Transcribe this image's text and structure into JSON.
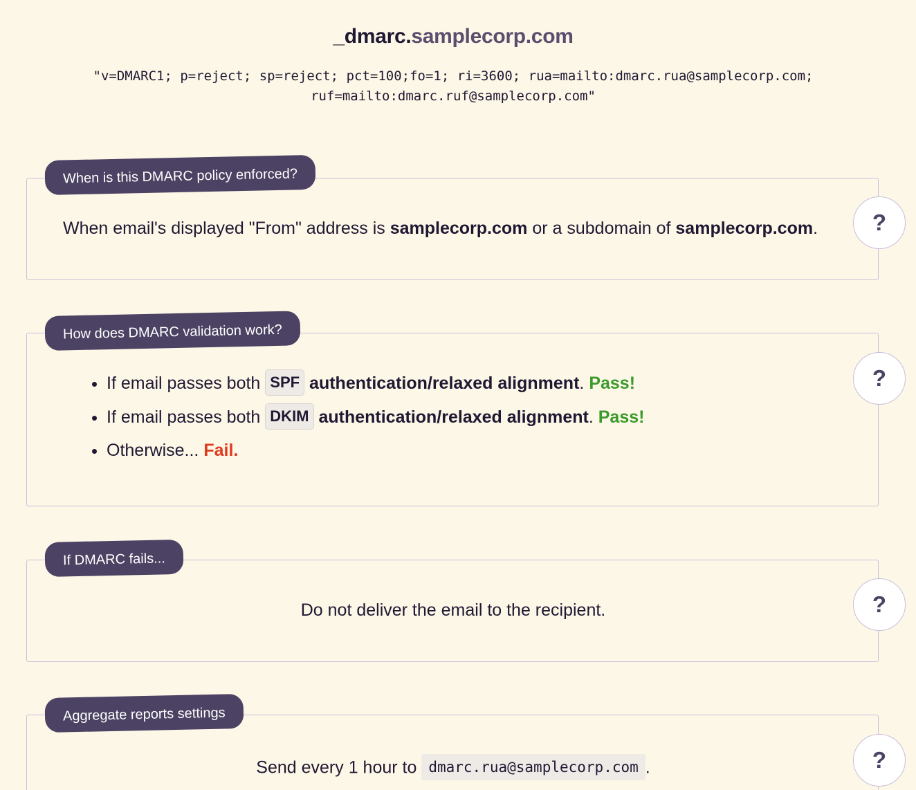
{
  "header": {
    "subdomain_prefix": "_dmarc.",
    "domain": "samplecorp.com",
    "record_line1": "\"v=DMARC1; p=reject; sp=reject; pct=100;fo=1; ri=3600; rua=mailto:dmarc.rua@samplecorp.com;",
    "record_line2": "ruf=mailto:dmarc.ruf@samplecorp.com\""
  },
  "help_label": "?",
  "sections": {
    "enforced": {
      "title": "When is this DMARC policy enforced?",
      "text_1": "When email's displayed \"From\" address is ",
      "domain_1": "samplecorp.com",
      "text_2": " or a subdomain of ",
      "domain_2": "samplecorp.com",
      "text_3": "."
    },
    "validation": {
      "title": "How does DMARC validation work?",
      "items": [
        {
          "prefix": "If email passes both ",
          "mechanism": "SPF",
          "strong": "authentication/relaxed alignment",
          "dot": ". ",
          "result": "Pass!"
        },
        {
          "prefix": "If email passes both ",
          "mechanism": "DKIM",
          "strong": "authentication/relaxed alignment",
          "dot": ". ",
          "result": "Pass!"
        },
        {
          "prefix": "Otherwise... ",
          "result": "Fail."
        }
      ]
    },
    "fails": {
      "title": "If DMARC fails...",
      "text": "Do not deliver the email to the recipient."
    },
    "aggregate": {
      "title": "Aggregate reports settings",
      "text_1": "Send every 1 hour to ",
      "address": "dmarc.rua@samplecorp.com",
      "text_2": "."
    }
  },
  "colors": {
    "background": "#fdf7e7",
    "tag_background": "#4c4263",
    "pass": "#3a9a2a",
    "fail": "#e03a1f",
    "border": "#cabfdc"
  }
}
